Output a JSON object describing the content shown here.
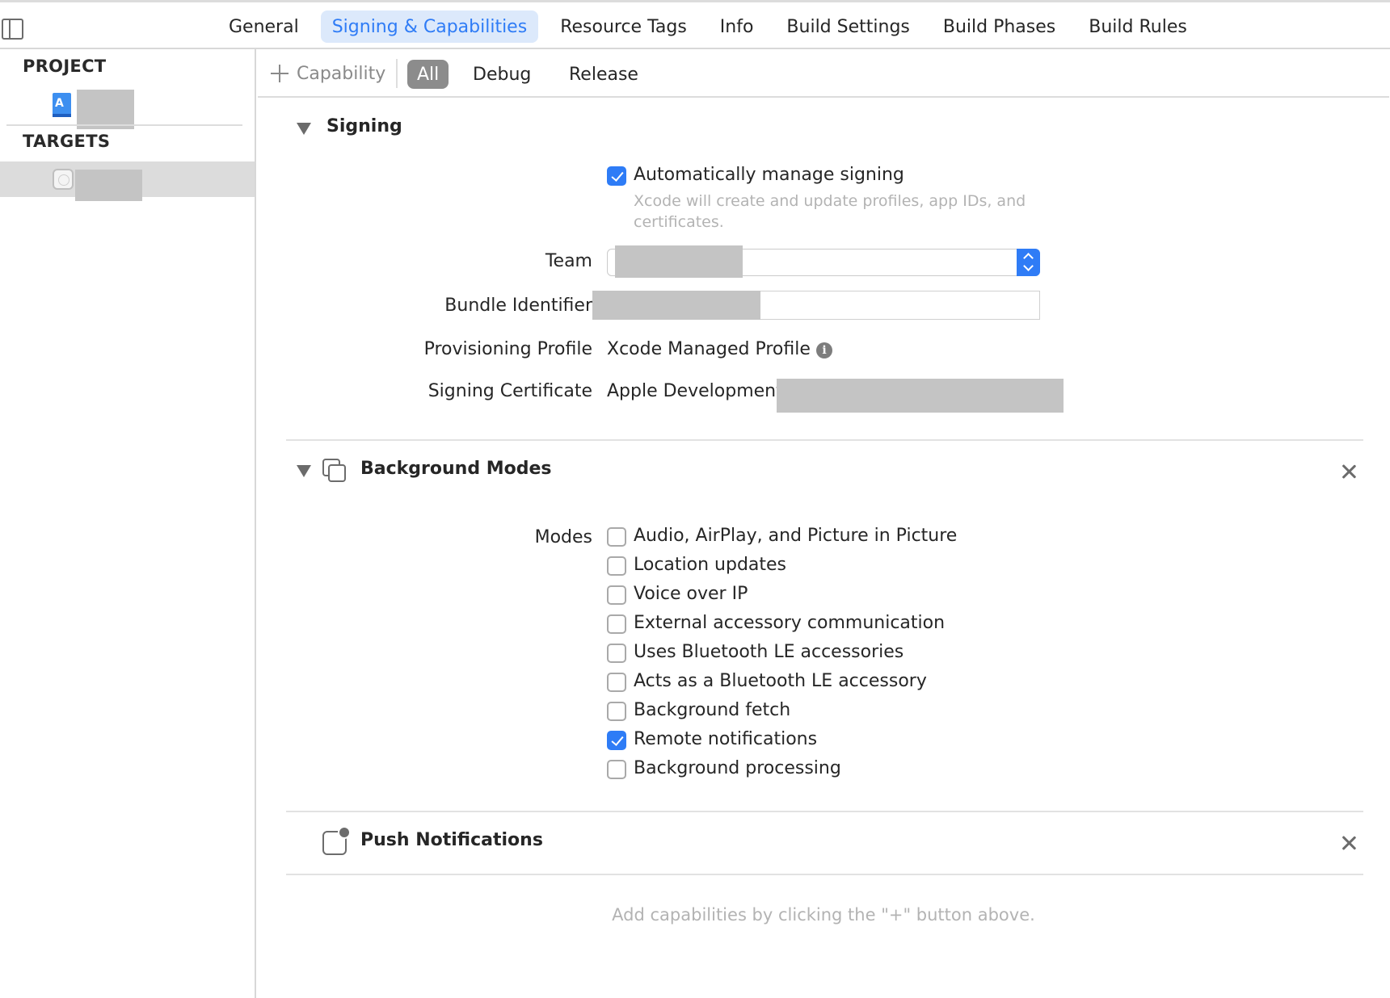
{
  "tabs": [
    {
      "label": "General"
    },
    {
      "label": "Signing & Capabilities",
      "active": true
    },
    {
      "label": "Resource Tags"
    },
    {
      "label": "Info"
    },
    {
      "label": "Build Settings"
    },
    {
      "label": "Build Phases"
    },
    {
      "label": "Build Rules"
    }
  ],
  "navigator": {
    "project_heading": "PROJECT",
    "targets_heading": "TARGETS"
  },
  "subbar": {
    "add_capability": "Capability",
    "filters": [
      {
        "label": "All",
        "active": true
      },
      {
        "label": "Debug"
      },
      {
        "label": "Release"
      }
    ]
  },
  "signing": {
    "title": "Signing",
    "auto_manage_label": "Automatically manage signing",
    "auto_manage_checked": true,
    "auto_manage_hint": "Xcode will create and update profiles, app IDs, and certificates.",
    "team_label": "Team",
    "bundle_label": "Bundle Identifier",
    "profile_label": "Provisioning Profile",
    "profile_value": "Xcode Managed Profile",
    "certificate_label": "Signing Certificate",
    "certificate_value": "Apple Development:"
  },
  "background_modes": {
    "title": "Background Modes",
    "modes_label": "Modes",
    "modes": [
      {
        "label": "Audio, AirPlay, and Picture in Picture",
        "checked": false
      },
      {
        "label": "Location updates",
        "checked": false
      },
      {
        "label": "Voice over IP",
        "checked": false
      },
      {
        "label": "External accessory communication",
        "checked": false
      },
      {
        "label": "Uses Bluetooth LE accessories",
        "checked": false
      },
      {
        "label": "Acts as a Bluetooth LE accessory",
        "checked": false
      },
      {
        "label": "Background fetch",
        "checked": false
      },
      {
        "label": "Remote notifications",
        "checked": true
      },
      {
        "label": "Background processing",
        "checked": false
      }
    ]
  },
  "push_notifications": {
    "title": "Push Notifications"
  },
  "footer_hint": "Add capabilities by clicking the \"+\" button above.",
  "colors": {
    "accent": "#2f7cf6",
    "active_tab_bg": "#dce9fb",
    "active_filter_bg": "#8c8c8c"
  }
}
